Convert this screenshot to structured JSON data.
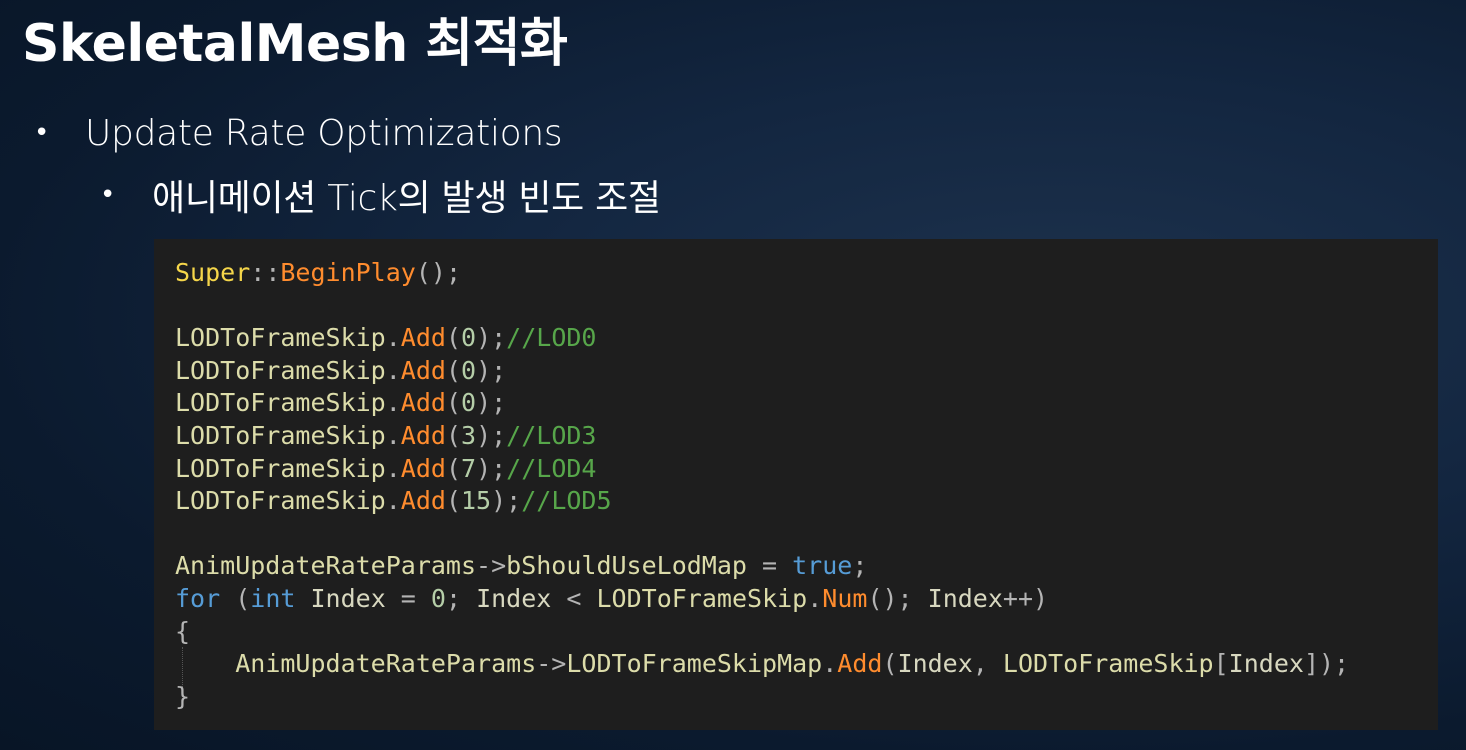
{
  "slide": {
    "title": "SkeletalMesh 최적화",
    "bullets": [
      {
        "level": 1,
        "text": "Update Rate Optimizations"
      },
      {
        "level": 2,
        "text": "애니메이션 Tick의 발생 빈도 조절"
      }
    ],
    "bullet_glyph": "•"
  },
  "colors": {
    "background": "#0b1a2e",
    "title_text": "#ffffff",
    "code_background": "#1e1e1e",
    "syntax": {
      "type": "#f5d64a",
      "function": "#ff8c2e",
      "comment": "#57a64a",
      "keyword": "#569cd6",
      "number": "#b5cea8",
      "variable": "#dcdcaa",
      "punctuation": "#b4b4b4"
    }
  },
  "code": {
    "language": "cpp",
    "lines": [
      [
        {
          "t": "Super",
          "k": "type"
        },
        {
          "t": "::",
          "k": "punct"
        },
        {
          "t": "BeginPlay",
          "k": "func"
        },
        {
          "t": "();",
          "k": "punct"
        }
      ],
      [],
      [
        {
          "t": "LODToFrameSkip",
          "k": "var"
        },
        {
          "t": ".",
          "k": "punct"
        },
        {
          "t": "Add",
          "k": "func"
        },
        {
          "t": "(",
          "k": "punct"
        },
        {
          "t": "0",
          "k": "num"
        },
        {
          "t": ");",
          "k": "punct"
        },
        {
          "t": "//LOD0",
          "k": "comment"
        }
      ],
      [
        {
          "t": "LODToFrameSkip",
          "k": "var"
        },
        {
          "t": ".",
          "k": "punct"
        },
        {
          "t": "Add",
          "k": "func"
        },
        {
          "t": "(",
          "k": "punct"
        },
        {
          "t": "0",
          "k": "num"
        },
        {
          "t": ");",
          "k": "punct"
        }
      ],
      [
        {
          "t": "LODToFrameSkip",
          "k": "var"
        },
        {
          "t": ".",
          "k": "punct"
        },
        {
          "t": "Add",
          "k": "func"
        },
        {
          "t": "(",
          "k": "punct"
        },
        {
          "t": "0",
          "k": "num"
        },
        {
          "t": ");",
          "k": "punct"
        }
      ],
      [
        {
          "t": "LODToFrameSkip",
          "k": "var"
        },
        {
          "t": ".",
          "k": "punct"
        },
        {
          "t": "Add",
          "k": "func"
        },
        {
          "t": "(",
          "k": "punct"
        },
        {
          "t": "3",
          "k": "num"
        },
        {
          "t": ");",
          "k": "punct"
        },
        {
          "t": "//LOD3",
          "k": "comment"
        }
      ],
      [
        {
          "t": "LODToFrameSkip",
          "k": "var"
        },
        {
          "t": ".",
          "k": "punct"
        },
        {
          "t": "Add",
          "k": "func"
        },
        {
          "t": "(",
          "k": "punct"
        },
        {
          "t": "7",
          "k": "num"
        },
        {
          "t": ");",
          "k": "punct"
        },
        {
          "t": "//LOD4",
          "k": "comment"
        }
      ],
      [
        {
          "t": "LODToFrameSkip",
          "k": "var"
        },
        {
          "t": ".",
          "k": "punct"
        },
        {
          "t": "Add",
          "k": "func"
        },
        {
          "t": "(",
          "k": "punct"
        },
        {
          "t": "15",
          "k": "num"
        },
        {
          "t": ");",
          "k": "punct"
        },
        {
          "t": "//LOD5",
          "k": "comment"
        }
      ],
      [],
      [
        {
          "t": "AnimUpdateRateParams",
          "k": "var"
        },
        {
          "t": "->",
          "k": "punct"
        },
        {
          "t": "bShouldUseLodMap",
          "k": "var"
        },
        {
          "t": " = ",
          "k": "punct"
        },
        {
          "t": "true",
          "k": "keyword"
        },
        {
          "t": ";",
          "k": "punct"
        }
      ],
      [
        {
          "t": "for",
          "k": "keyword"
        },
        {
          "t": " (",
          "k": "punct"
        },
        {
          "t": "int",
          "k": "keyword"
        },
        {
          "t": " ",
          "k": "punct"
        },
        {
          "t": "Index",
          "k": "id"
        },
        {
          "t": " = ",
          "k": "punct"
        },
        {
          "t": "0",
          "k": "num"
        },
        {
          "t": "; ",
          "k": "punct"
        },
        {
          "t": "Index",
          "k": "id"
        },
        {
          "t": " < ",
          "k": "punct"
        },
        {
          "t": "LODToFrameSkip",
          "k": "var"
        },
        {
          "t": ".",
          "k": "punct"
        },
        {
          "t": "Num",
          "k": "func"
        },
        {
          "t": "(); ",
          "k": "punct"
        },
        {
          "t": "Index",
          "k": "id"
        },
        {
          "t": "++)",
          "k": "punct"
        }
      ],
      [
        {
          "t": "{",
          "k": "punct"
        }
      ],
      [
        {
          "t": "    ",
          "k": "punct"
        },
        {
          "t": "AnimUpdateRateParams",
          "k": "var"
        },
        {
          "t": "->",
          "k": "punct"
        },
        {
          "t": "LODToFrameSkipMap",
          "k": "var"
        },
        {
          "t": ".",
          "k": "punct"
        },
        {
          "t": "Add",
          "k": "func"
        },
        {
          "t": "(",
          "k": "punct"
        },
        {
          "t": "Index",
          "k": "id"
        },
        {
          "t": ", ",
          "k": "punct"
        },
        {
          "t": "LODToFrameSkip",
          "k": "var"
        },
        {
          "t": "[",
          "k": "punct"
        },
        {
          "t": "Index",
          "k": "id"
        },
        {
          "t": "]);",
          "k": "punct"
        }
      ],
      [
        {
          "t": "}",
          "k": "punct"
        }
      ]
    ]
  }
}
